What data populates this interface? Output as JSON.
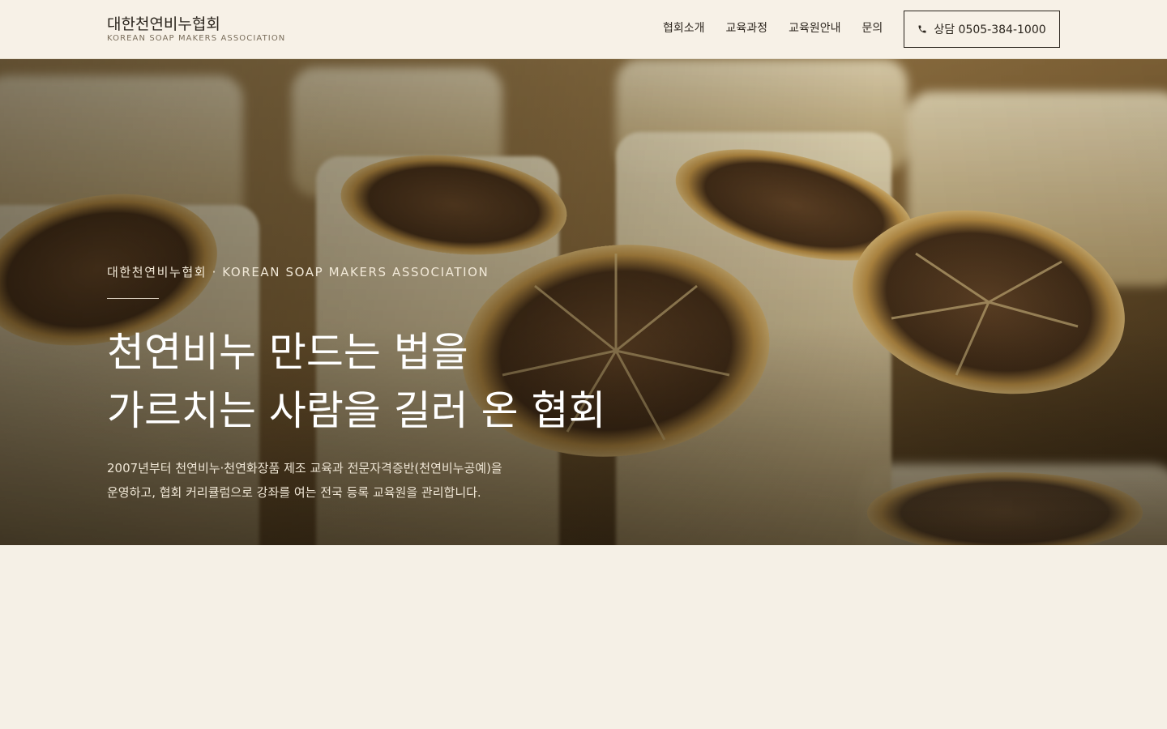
{
  "header": {
    "brand_ko": "대한천연비누협회",
    "brand_en": "KOREAN SOAP MAKERS ASSOCIATION",
    "nav": [
      {
        "label": "협회소개"
      },
      {
        "label": "교육과정"
      },
      {
        "label": "교육원안내"
      },
      {
        "label": "문의"
      }
    ],
    "cta_label": "상담 0505-384-1000",
    "cta_icon": "phone-icon"
  },
  "hero": {
    "eyebrow": "대한천연비누협회 · KOREAN SOAP MAKERS ASSOCIATION",
    "headline_line1": "천연비누 만드는 법을",
    "headline_line2": "가르치는 사람을 길러 온 협회",
    "desc_line1": "2007년부터 천연비누·천연화장품 제조 교육과 전문자격증반(천연비누공예)을",
    "desc_line2": "운영하고, 협회 커리큘럼으로 강좌를 여는 전국 등록 교육원을 관리합니다.",
    "image": "handmade-soap-bars-with-dried-orange-slices"
  },
  "colors": {
    "page_bg": "#f5f0e6",
    "header_bg": "#f7f1e7",
    "text_dark": "#2a241c",
    "hero_text": "#ffffff"
  }
}
